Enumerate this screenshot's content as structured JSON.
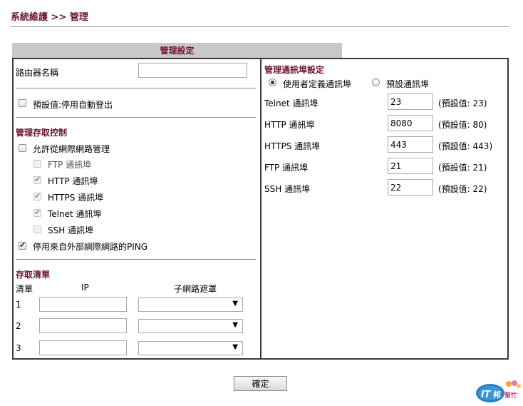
{
  "breadcrumb": "系統維護 >> 管理",
  "section_title": "管理設定",
  "left": {
    "router_name_label": "路由器名稱",
    "router_name_value": "",
    "auto_logout_label": "預設值:停用自動登出",
    "access_control_title": "管理存取控制",
    "allow_internet_label": "允許從網際網路管理",
    "services": [
      {
        "label": "FTP 通訊埠",
        "checked": false
      },
      {
        "label": "HTTP 通訊埠",
        "checked": true
      },
      {
        "label": "HTTPS 通訊埠",
        "checked": true
      },
      {
        "label": "Telnet 通訊埠",
        "checked": true
      },
      {
        "label": "SSH 通訊埠",
        "checked": false
      }
    ],
    "disable_ping_label": "停用來自外部網際網路的PING",
    "access_list_title": "存取清單",
    "list_headers": {
      "index": "清單",
      "ip": "IP",
      "mask": "子網路遮罩"
    },
    "list_rows": [
      {
        "index": "1",
        "ip": "",
        "mask": ""
      },
      {
        "index": "2",
        "ip": "",
        "mask": ""
      },
      {
        "index": "3",
        "ip": "",
        "mask": ""
      }
    ]
  },
  "right": {
    "title": "管理通訊埠設定",
    "radio_custom_label": "使用者定義通訊埠",
    "radio_default_label": "預設通訊埠",
    "ports": [
      {
        "label": "Telnet 通訊埠",
        "value": "23",
        "default": "(預設值: 23)"
      },
      {
        "label": "HTTP 通訊埠",
        "value": "8080",
        "default": "(預設值: 80)"
      },
      {
        "label": "HTTPS 通訊埠",
        "value": "443",
        "default": "(預設值: 443)"
      },
      {
        "label": "FTP 通訊埠",
        "value": "21",
        "default": "(預設值: 21)"
      },
      {
        "label": "SSH 通訊埠",
        "value": "22",
        "default": "(預設值: 22)"
      }
    ]
  },
  "ok_button": "確定",
  "watermark": {
    "text_it": "IT",
    "text_bang": "邦",
    "text_help": "幫忙"
  }
}
